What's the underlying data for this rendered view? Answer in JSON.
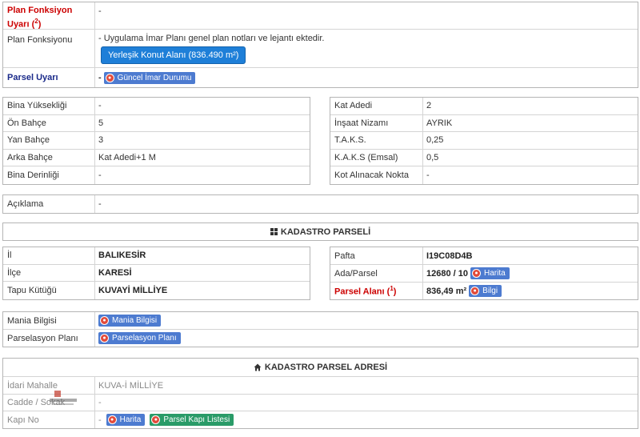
{
  "top": {
    "plan_fonksiyon_uyari_label": "Plan Fonksiyon Uyarı",
    "plan_fonksiyon_uyari_sup": "2",
    "plan_fonksiyon_uyari_value": "-",
    "plan_fonksiyonu_label": "Plan Fonksiyonu",
    "plan_fonksiyonu_note": "- Uygulama İmar Planı genel plan notları ve lejantı ektedir.",
    "plan_fonksiyonu_button": "Yerleşik Konut Alanı (836.490 m²)",
    "parsel_uyari_label": "Parsel Uyarı",
    "parsel_uyari_dash": "-",
    "guncel_imar_button": "Güncel İmar Durumu"
  },
  "left_details": [
    {
      "label": "Bina Yüksekliği",
      "value": "-"
    },
    {
      "label": "Ön Bahçe",
      "value": "5"
    },
    {
      "label": "Yan Bahçe",
      "value": "3"
    },
    {
      "label": "Arka Bahçe",
      "value": "Kat Adedi+1 M"
    },
    {
      "label": "Bina Derinliği",
      "value": "-"
    }
  ],
  "right_details": [
    {
      "label": "Kat Adedi",
      "value": "2"
    },
    {
      "label": "İnşaat Nizamı",
      "value": "AYRIK"
    },
    {
      "label": "T.A.K.S.",
      "value": "0,25"
    },
    {
      "label": "K.A.K.S (Emsal)",
      "value": "0,5"
    },
    {
      "label": "Kot Alınacak Nokta",
      "value": "-"
    }
  ],
  "aciklama": {
    "label": "Açıklama",
    "value": "-"
  },
  "kadastro_parseli": {
    "title": "KADASTRO PARSELİ"
  },
  "parcel_left": [
    {
      "label": "İl",
      "value": "BALIKESİR"
    },
    {
      "label": "İlçe",
      "value": "KARESİ"
    },
    {
      "label": "Tapu Kütüğü",
      "value": "KUVAYİ MİLLİYE"
    }
  ],
  "parcel_right": {
    "pafta_label": "Pafta",
    "pafta_value": "I19C08D4B",
    "ada_label": "Ada/Parsel",
    "ada_value": "12680 / 10",
    "harita_button": "Harita",
    "alan_label": "Parsel Alanı",
    "alan_sup": "1",
    "alan_value": "836,49 m²",
    "bilgi_button": "Bilgi"
  },
  "mania": {
    "mania_label": "Mania Bilgisi",
    "mania_button": "Mania Bilgisi",
    "parselasyon_label": "Parselasyon Planı",
    "parselasyon_button": "Parselasyon Planı"
  },
  "kadastro_adres": {
    "title": "KADASTRO PARSEL ADRESİ",
    "mahalle_label": "İdari Mahalle",
    "mahalle_value": "KUVA-İ MİLLİYE",
    "cadde_label": "Cadde / Sokak",
    "cadde_value": "-",
    "kapi_label": "Kapı No",
    "kapi_dash": "-",
    "harita_button": "Harita",
    "kapi_listesi_button": "Parsel Kapı Listesi"
  },
  "colors": {
    "button_blue": "#1e7fd8",
    "pill_blue": "#4d7bd0",
    "pill_green": "#2a9b68",
    "warning_red": "#cc0000",
    "label_navy": "#1a2a8a"
  }
}
